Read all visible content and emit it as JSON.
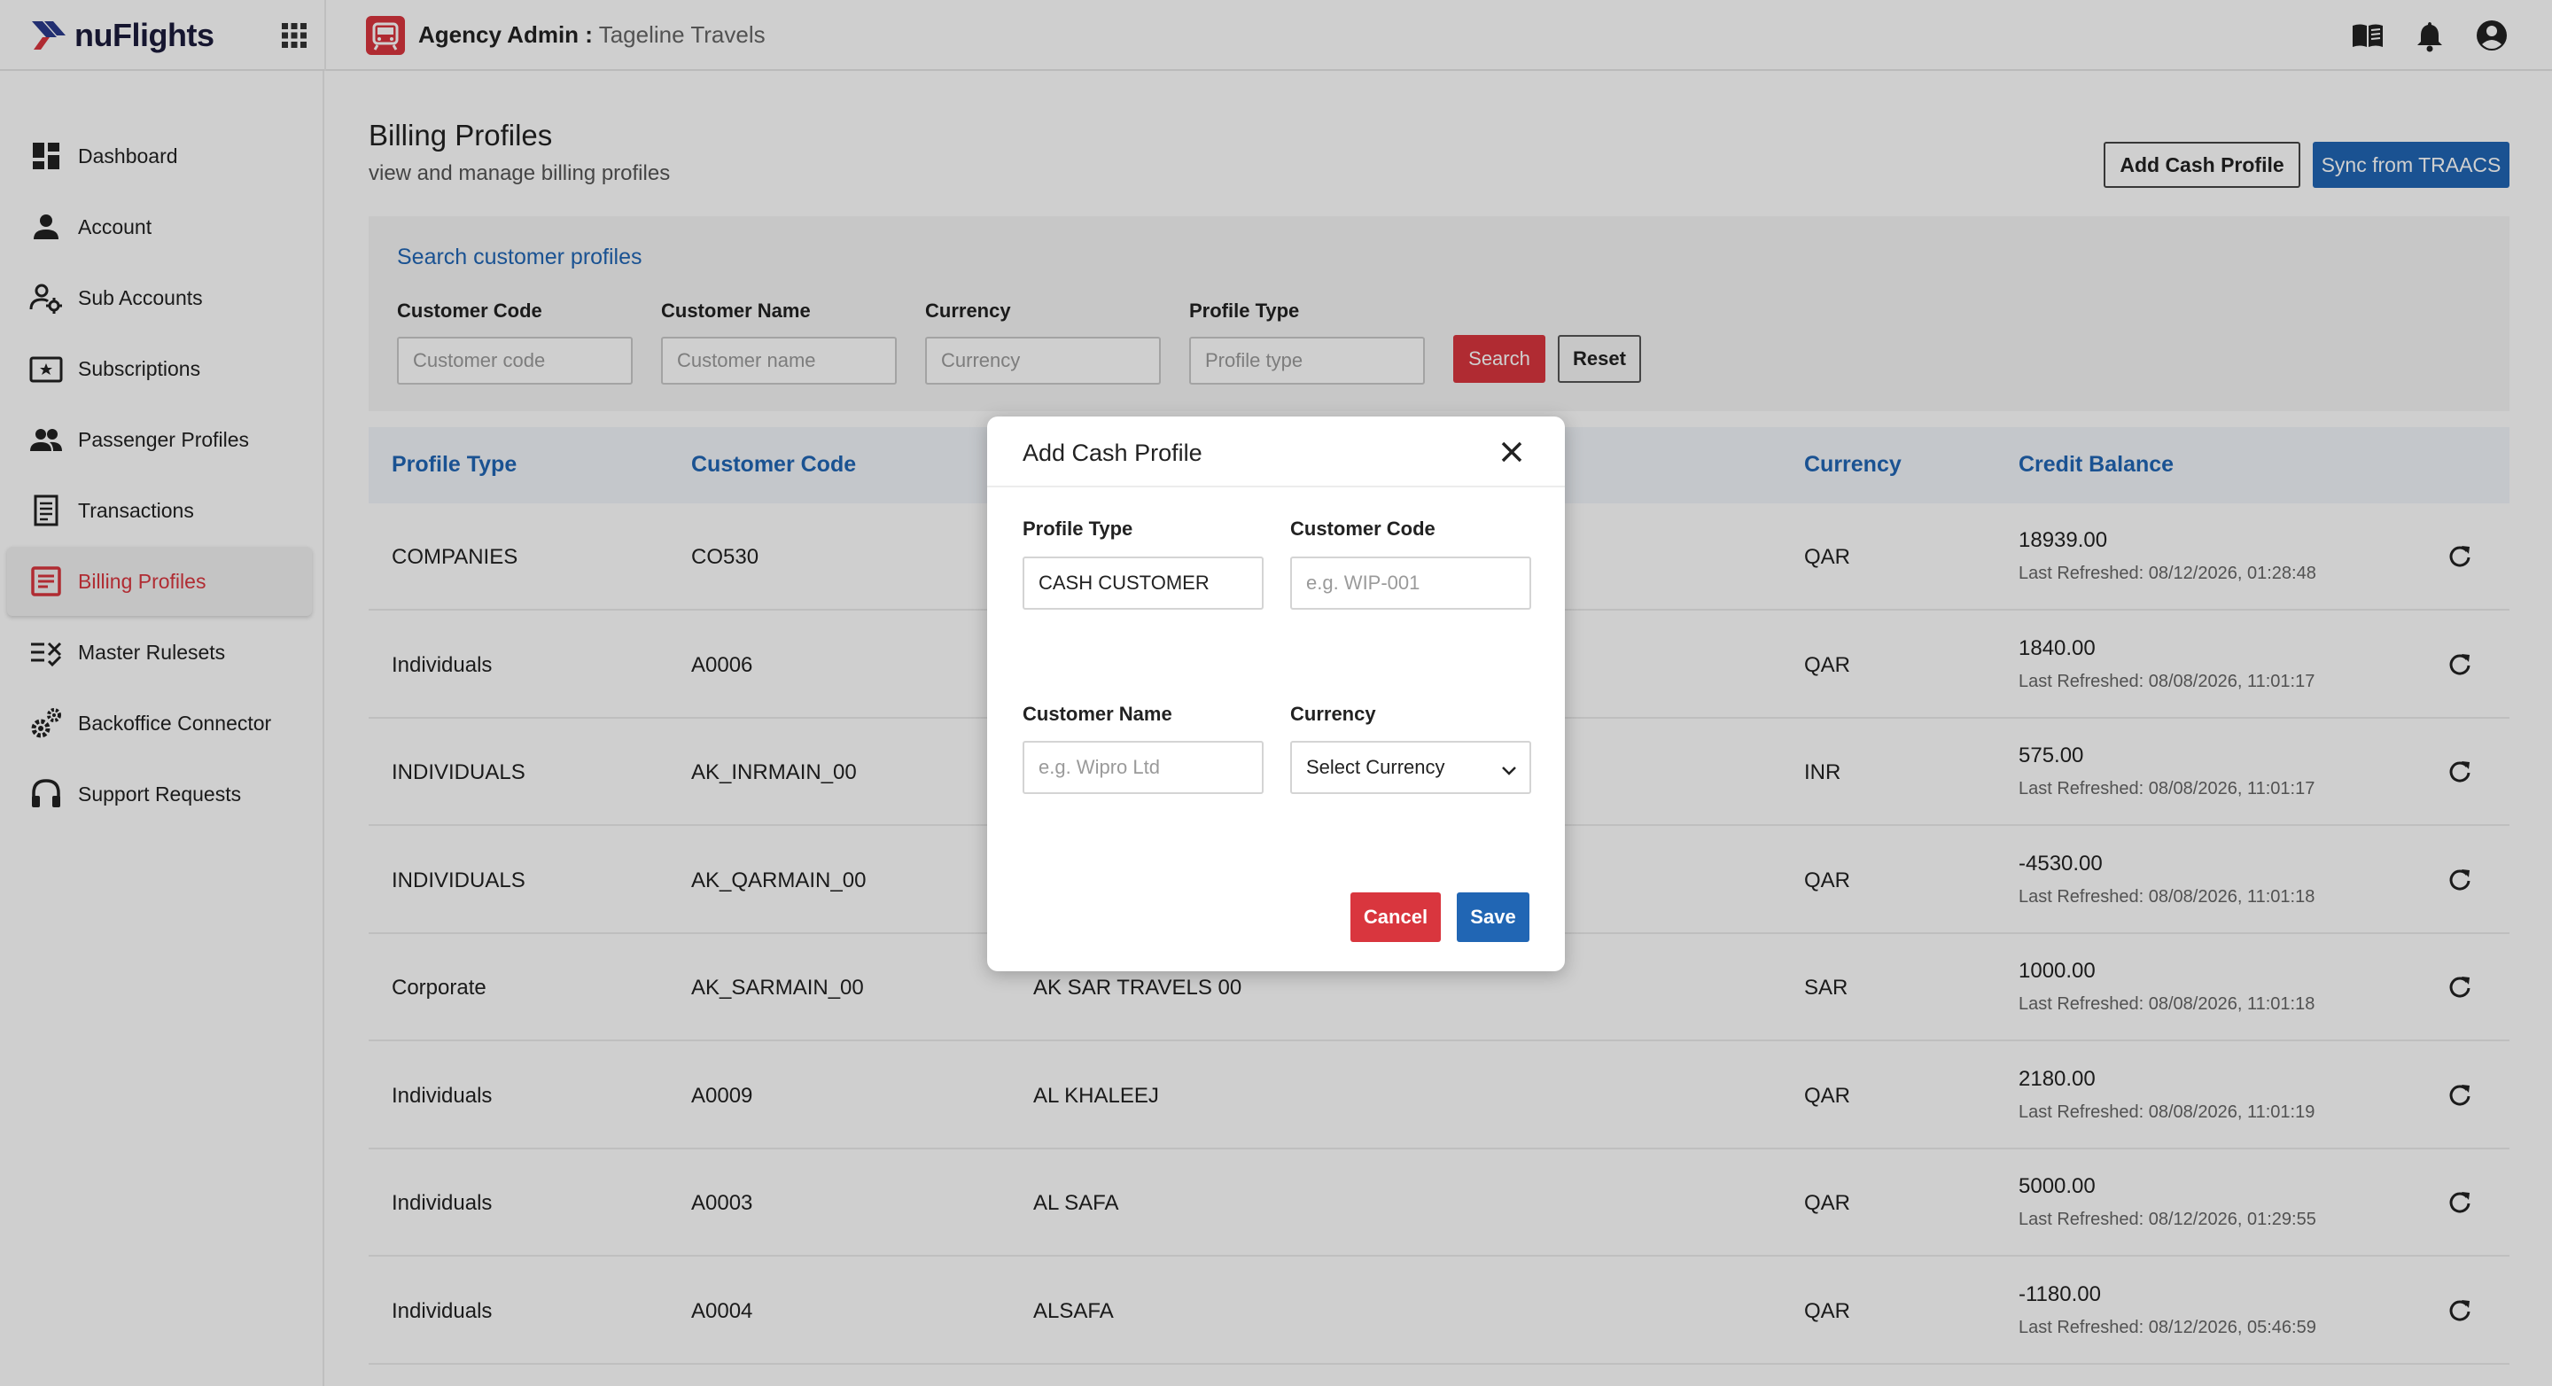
{
  "header": {
    "logo_text": "nuFlights",
    "agency_label": "Agency Admin :",
    "agency_name": "Tageline Travels",
    "icons": [
      "apps-grid-icon",
      "agency-icon",
      "docs-book-icon",
      "bell-icon",
      "account-circle-icon"
    ]
  },
  "sidebar": {
    "items": [
      {
        "label": "Dashboard",
        "icon": "dashboard-icon"
      },
      {
        "label": "Account",
        "icon": "person-icon"
      },
      {
        "label": "Sub Accounts",
        "icon": "sub-accounts-icon"
      },
      {
        "label": "Subscriptions",
        "icon": "subscriptions-icon"
      },
      {
        "label": "Passenger Profiles",
        "icon": "people-icon"
      },
      {
        "label": "Transactions",
        "icon": "receipt-icon"
      },
      {
        "label": "Billing Profiles",
        "icon": "billing-icon",
        "active": true
      },
      {
        "label": "Master Rulesets",
        "icon": "rules-icon"
      },
      {
        "label": "Backoffice Connector",
        "icon": "gears-icon"
      },
      {
        "label": "Support Requests",
        "icon": "headset-icon"
      }
    ]
  },
  "page": {
    "title": "Billing Profiles",
    "subtitle": "view and manage billing profiles",
    "add_cash_label": "Add Cash Profile",
    "sync_label": "Sync from TRAACS"
  },
  "search": {
    "title": "Search customer profiles",
    "fields": [
      {
        "label": "Customer Code",
        "placeholder": "Customer code"
      },
      {
        "label": "Customer Name",
        "placeholder": "Customer name"
      },
      {
        "label": "Currency",
        "placeholder": "Currency"
      },
      {
        "label": "Profile Type",
        "placeholder": "Profile type"
      }
    ],
    "search_label": "Search",
    "reset_label": "Reset"
  },
  "table": {
    "columns": [
      "Profile Type",
      "Customer Code",
      "Currency",
      "Credit Balance"
    ],
    "rows": [
      {
        "profile_type": "COMPANIES",
        "code": "CO530",
        "name": "",
        "currency": "QAR",
        "balance": "18939.00",
        "refreshed": "Last Refreshed: 08/12/2026, 01:28:48"
      },
      {
        "profile_type": "Individuals",
        "code": "A0006",
        "name": "",
        "currency": "QAR",
        "balance": "1840.00",
        "refreshed": "Last Refreshed: 08/08/2026, 11:01:17"
      },
      {
        "profile_type": "INDIVIDUALS",
        "code": "AK_INRMAIN_00",
        "name": "",
        "currency": "INR",
        "balance": "575.00",
        "refreshed": "Last Refreshed: 08/08/2026, 11:01:17"
      },
      {
        "profile_type": "INDIVIDUALS",
        "code": "AK_QARMAIN_00",
        "name": "",
        "currency": "QAR",
        "balance": "-4530.00",
        "refreshed": "Last Refreshed: 08/08/2026, 11:01:18"
      },
      {
        "profile_type": "Corporate",
        "code": "AK_SARMAIN_00",
        "name": "AK SAR TRAVELS 00",
        "currency": "SAR",
        "balance": "1000.00",
        "refreshed": "Last Refreshed: 08/08/2026, 11:01:18"
      },
      {
        "profile_type": "Individuals",
        "code": "A0009",
        "name": "AL KHALEEJ",
        "currency": "QAR",
        "balance": "2180.00",
        "refreshed": "Last Refreshed: 08/08/2026, 11:01:19"
      },
      {
        "profile_type": "Individuals",
        "code": "A0003",
        "name": "AL SAFA",
        "currency": "QAR",
        "balance": "5000.00",
        "refreshed": "Last Refreshed: 08/12/2026, 01:29:55"
      },
      {
        "profile_type": "Individuals",
        "code": "A0004",
        "name": "ALSAFA",
        "currency": "QAR",
        "balance": "-1180.00",
        "refreshed": "Last Refreshed: 08/12/2026, 05:46:59"
      }
    ]
  },
  "modal": {
    "title": "Add Cash Profile",
    "profile_type_label": "Profile Type",
    "profile_type_value": "CASH CUSTOMER",
    "customer_code_label": "Customer Code",
    "customer_code_placeholder": "e.g. WIP-001",
    "customer_name_label": "Customer Name",
    "customer_name_placeholder": "e.g. Wipro Ltd",
    "currency_label": "Currency",
    "currency_value": "Select Currency",
    "cancel_label": "Cancel",
    "save_label": "Save"
  },
  "colors": {
    "accent_blue": "#2166b4",
    "danger_red": "#d9363e",
    "brand_navy": "#2b3a8c"
  }
}
